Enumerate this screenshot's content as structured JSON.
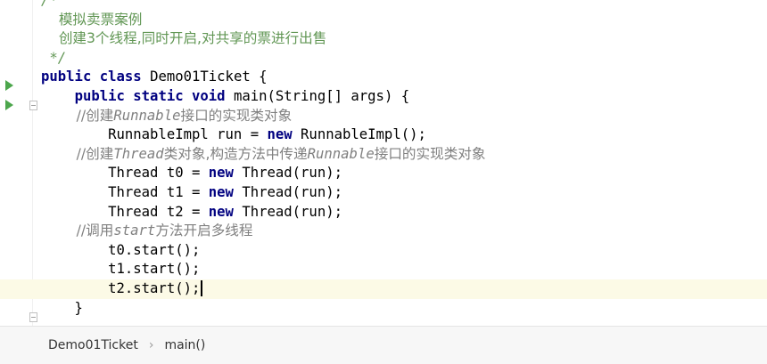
{
  "editor": {
    "lines": [
      {
        "parts": [
          {
            "t": "/*",
            "c": "jd"
          }
        ]
      },
      {
        "parts": [
          {
            "t": "    模拟卖票案例",
            "c": "jd-plain"
          }
        ]
      },
      {
        "parts": [
          {
            "t": "    创建3个线程,同时开启,对共享的票进行出售",
            "c": "jd-plain"
          }
        ]
      },
      {
        "parts": [
          {
            "t": " */",
            "c": "jd"
          }
        ]
      },
      {
        "parts": [
          {
            "t": "public ",
            "c": "kw"
          },
          {
            "t": "class ",
            "c": "kw"
          },
          {
            "t": "Demo01Ticket {",
            "c": ""
          }
        ]
      },
      {
        "parts": [
          {
            "t": "    ",
            "c": ""
          },
          {
            "t": "public ",
            "c": "kw"
          },
          {
            "t": "static ",
            "c": "kw"
          },
          {
            "t": "void ",
            "c": "kw"
          },
          {
            "t": "main(String[] args) {",
            "c": ""
          }
        ]
      },
      {
        "parts": [
          {
            "t": "        //创建",
            "c": "cm-plain"
          },
          {
            "t": "Runnable",
            "c": "cm"
          },
          {
            "t": "接口的实现类对象",
            "c": "cm-plain"
          }
        ]
      },
      {
        "parts": [
          {
            "t": "        RunnableImpl run = ",
            "c": ""
          },
          {
            "t": "new ",
            "c": "kw"
          },
          {
            "t": "RunnableImpl();",
            "c": ""
          }
        ]
      },
      {
        "parts": [
          {
            "t": "        //创建",
            "c": "cm-plain"
          },
          {
            "t": "Thread",
            "c": "cm"
          },
          {
            "t": "类对象,构造方法中传递",
            "c": "cm-plain"
          },
          {
            "t": "Runnable",
            "c": "cm"
          },
          {
            "t": "接口的实现类对象",
            "c": "cm-plain"
          }
        ]
      },
      {
        "parts": [
          {
            "t": "        Thread t0 = ",
            "c": ""
          },
          {
            "t": "new ",
            "c": "kw"
          },
          {
            "t": "Thread(run);",
            "c": ""
          }
        ]
      },
      {
        "parts": [
          {
            "t": "        Thread t1 = ",
            "c": ""
          },
          {
            "t": "new ",
            "c": "kw"
          },
          {
            "t": "Thread(run);",
            "c": ""
          }
        ]
      },
      {
        "parts": [
          {
            "t": "        Thread t2 = ",
            "c": ""
          },
          {
            "t": "new ",
            "c": "kw"
          },
          {
            "t": "Thread(run);",
            "c": ""
          }
        ]
      },
      {
        "parts": [
          {
            "t": "        //调用",
            "c": "cm-plain"
          },
          {
            "t": "start",
            "c": "cm"
          },
          {
            "t": "方法开启多线程",
            "c": "cm-plain"
          }
        ]
      },
      {
        "parts": [
          {
            "t": "        t0.start();",
            "c": ""
          }
        ]
      },
      {
        "parts": [
          {
            "t": "        t1.start();",
            "c": ""
          }
        ]
      },
      {
        "parts": [
          {
            "t": "        t2.start();",
            "c": ""
          }
        ],
        "current": true
      },
      {
        "parts": [
          {
            "t": "    }",
            "c": ""
          }
        ]
      }
    ]
  },
  "breadcrumb": {
    "items": [
      "Demo01Ticket",
      "main()"
    ],
    "separator": "›"
  },
  "colors": {
    "keyword": "#000080",
    "comment": "#808080",
    "javadoc": "#629755",
    "run_icon": "#4ca64c",
    "current_line": "#fcfae6"
  }
}
